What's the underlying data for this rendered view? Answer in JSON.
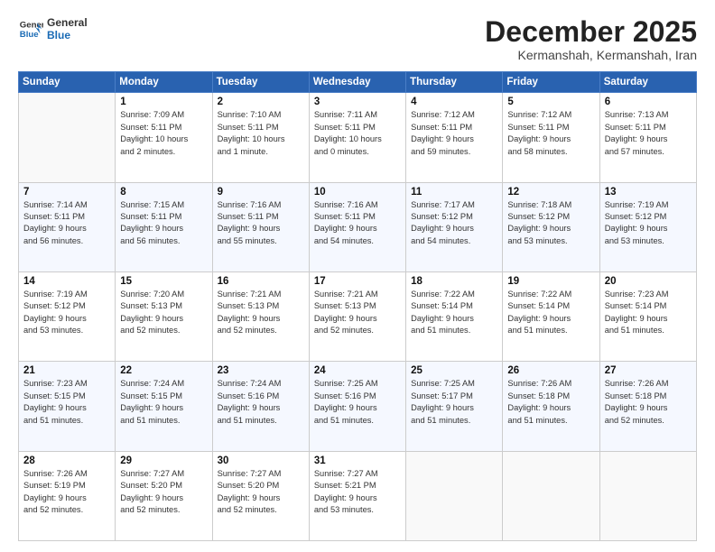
{
  "logo": {
    "line1": "General",
    "line2": "Blue"
  },
  "title": "December 2025",
  "location": "Kermanshah, Kermanshah, Iran",
  "header_days": [
    "Sunday",
    "Monday",
    "Tuesday",
    "Wednesday",
    "Thursday",
    "Friday",
    "Saturday"
  ],
  "weeks": [
    [
      {
        "day": "",
        "info": ""
      },
      {
        "day": "1",
        "info": "Sunrise: 7:09 AM\nSunset: 5:11 PM\nDaylight: 10 hours\nand 2 minutes."
      },
      {
        "day": "2",
        "info": "Sunrise: 7:10 AM\nSunset: 5:11 PM\nDaylight: 10 hours\nand 1 minute."
      },
      {
        "day": "3",
        "info": "Sunrise: 7:11 AM\nSunset: 5:11 PM\nDaylight: 10 hours\nand 0 minutes."
      },
      {
        "day": "4",
        "info": "Sunrise: 7:12 AM\nSunset: 5:11 PM\nDaylight: 9 hours\nand 59 minutes."
      },
      {
        "day": "5",
        "info": "Sunrise: 7:12 AM\nSunset: 5:11 PM\nDaylight: 9 hours\nand 58 minutes."
      },
      {
        "day": "6",
        "info": "Sunrise: 7:13 AM\nSunset: 5:11 PM\nDaylight: 9 hours\nand 57 minutes."
      }
    ],
    [
      {
        "day": "7",
        "info": "Sunrise: 7:14 AM\nSunset: 5:11 PM\nDaylight: 9 hours\nand 56 minutes."
      },
      {
        "day": "8",
        "info": "Sunrise: 7:15 AM\nSunset: 5:11 PM\nDaylight: 9 hours\nand 56 minutes."
      },
      {
        "day": "9",
        "info": "Sunrise: 7:16 AM\nSunset: 5:11 PM\nDaylight: 9 hours\nand 55 minutes."
      },
      {
        "day": "10",
        "info": "Sunrise: 7:16 AM\nSunset: 5:11 PM\nDaylight: 9 hours\nand 54 minutes."
      },
      {
        "day": "11",
        "info": "Sunrise: 7:17 AM\nSunset: 5:12 PM\nDaylight: 9 hours\nand 54 minutes."
      },
      {
        "day": "12",
        "info": "Sunrise: 7:18 AM\nSunset: 5:12 PM\nDaylight: 9 hours\nand 53 minutes."
      },
      {
        "day": "13",
        "info": "Sunrise: 7:19 AM\nSunset: 5:12 PM\nDaylight: 9 hours\nand 53 minutes."
      }
    ],
    [
      {
        "day": "14",
        "info": "Sunrise: 7:19 AM\nSunset: 5:12 PM\nDaylight: 9 hours\nand 53 minutes."
      },
      {
        "day": "15",
        "info": "Sunrise: 7:20 AM\nSunset: 5:13 PM\nDaylight: 9 hours\nand 52 minutes."
      },
      {
        "day": "16",
        "info": "Sunrise: 7:21 AM\nSunset: 5:13 PM\nDaylight: 9 hours\nand 52 minutes."
      },
      {
        "day": "17",
        "info": "Sunrise: 7:21 AM\nSunset: 5:13 PM\nDaylight: 9 hours\nand 52 minutes."
      },
      {
        "day": "18",
        "info": "Sunrise: 7:22 AM\nSunset: 5:14 PM\nDaylight: 9 hours\nand 51 minutes."
      },
      {
        "day": "19",
        "info": "Sunrise: 7:22 AM\nSunset: 5:14 PM\nDaylight: 9 hours\nand 51 minutes."
      },
      {
        "day": "20",
        "info": "Sunrise: 7:23 AM\nSunset: 5:14 PM\nDaylight: 9 hours\nand 51 minutes."
      }
    ],
    [
      {
        "day": "21",
        "info": "Sunrise: 7:23 AM\nSunset: 5:15 PM\nDaylight: 9 hours\nand 51 minutes."
      },
      {
        "day": "22",
        "info": "Sunrise: 7:24 AM\nSunset: 5:15 PM\nDaylight: 9 hours\nand 51 minutes."
      },
      {
        "day": "23",
        "info": "Sunrise: 7:24 AM\nSunset: 5:16 PM\nDaylight: 9 hours\nand 51 minutes."
      },
      {
        "day": "24",
        "info": "Sunrise: 7:25 AM\nSunset: 5:16 PM\nDaylight: 9 hours\nand 51 minutes."
      },
      {
        "day": "25",
        "info": "Sunrise: 7:25 AM\nSunset: 5:17 PM\nDaylight: 9 hours\nand 51 minutes."
      },
      {
        "day": "26",
        "info": "Sunrise: 7:26 AM\nSunset: 5:18 PM\nDaylight: 9 hours\nand 51 minutes."
      },
      {
        "day": "27",
        "info": "Sunrise: 7:26 AM\nSunset: 5:18 PM\nDaylight: 9 hours\nand 52 minutes."
      }
    ],
    [
      {
        "day": "28",
        "info": "Sunrise: 7:26 AM\nSunset: 5:19 PM\nDaylight: 9 hours\nand 52 minutes."
      },
      {
        "day": "29",
        "info": "Sunrise: 7:27 AM\nSunset: 5:20 PM\nDaylight: 9 hours\nand 52 minutes."
      },
      {
        "day": "30",
        "info": "Sunrise: 7:27 AM\nSunset: 5:20 PM\nDaylight: 9 hours\nand 52 minutes."
      },
      {
        "day": "31",
        "info": "Sunrise: 7:27 AM\nSunset: 5:21 PM\nDaylight: 9 hours\nand 53 minutes."
      },
      {
        "day": "",
        "info": ""
      },
      {
        "day": "",
        "info": ""
      },
      {
        "day": "",
        "info": ""
      }
    ]
  ]
}
